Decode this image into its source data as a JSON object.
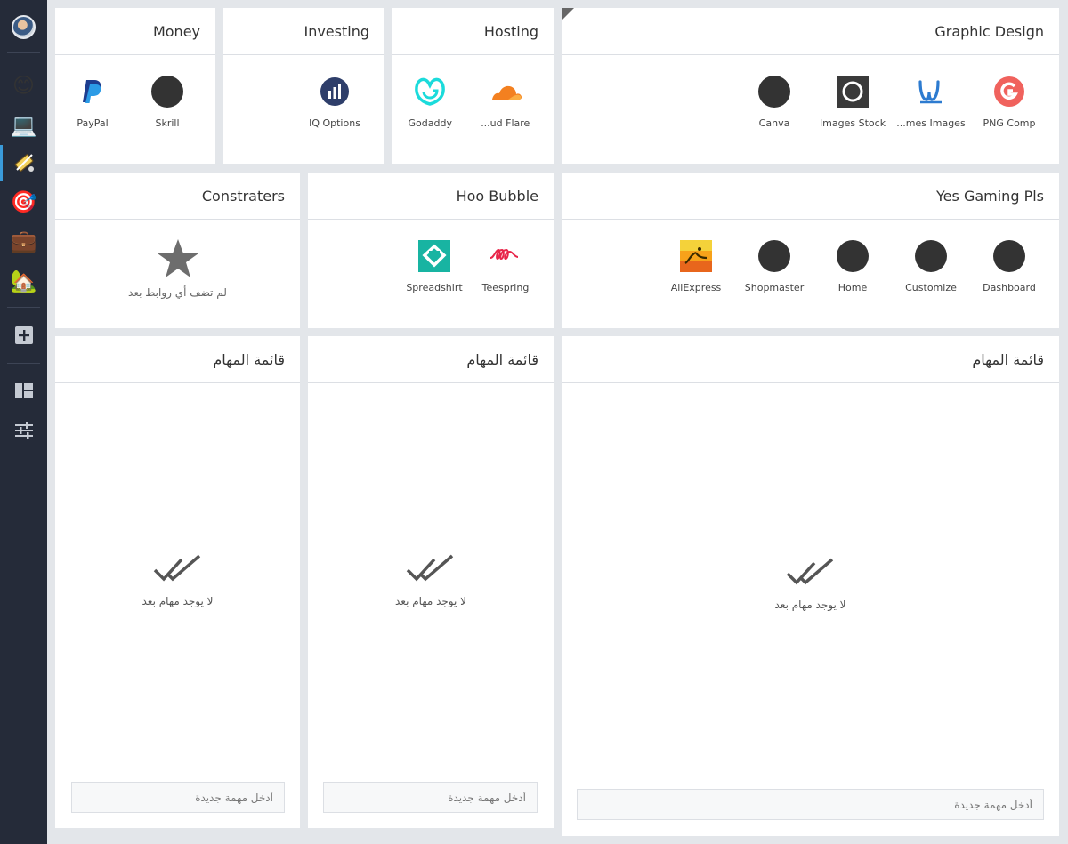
{
  "sidebar": {
    "items": [
      {
        "name": "avatar",
        "icon": "user-avatar"
      },
      {
        "name": "smiley",
        "icon": "smiley-face-icon",
        "glyph": "😊"
      },
      {
        "name": "laptop",
        "icon": "laptop-icon",
        "glyph": "💻"
      },
      {
        "name": "tools",
        "icon": "design-tools-icon",
        "active": true
      },
      {
        "name": "target",
        "icon": "target-icon",
        "glyph": "🎯"
      },
      {
        "name": "briefcase",
        "icon": "briefcase-icon",
        "glyph": "💼"
      },
      {
        "name": "house",
        "icon": "house-icon",
        "glyph": "🏡"
      },
      {
        "name": "add",
        "icon": "add-square-icon"
      },
      {
        "name": "dashboard",
        "icon": "dashboard-grid-icon"
      },
      {
        "name": "settings",
        "icon": "sliders-icon"
      }
    ]
  },
  "cards": {
    "money": {
      "title": "Money",
      "links": [
        {
          "label": "PayPal",
          "icon": "paypal-icon"
        },
        {
          "label": "Skrill",
          "icon": "dot"
        }
      ]
    },
    "investing": {
      "title": "Investing",
      "links": [
        {
          "label": "IQ Options",
          "icon": "iq-option-icon"
        }
      ]
    },
    "hosting": {
      "title": "Hosting",
      "links": [
        {
          "label": "Godaddy",
          "icon": "godaddy-icon"
        },
        {
          "label": "...ud Flare",
          "icon": "cloudflare-icon"
        }
      ]
    },
    "graphic": {
      "title": "Graphic Design",
      "links": [
        {
          "label": "Canva",
          "icon": "dot"
        },
        {
          "label": "Images Stock",
          "icon": "images-stock-icon"
        },
        {
          "label": "...mes Images",
          "icon": "w-logo-icon"
        },
        {
          "label": "PNG Comp",
          "icon": "png-comp-icon"
        }
      ]
    },
    "constraters": {
      "title": "Constraters",
      "empty_text": "لم تضف أي روابط بعد"
    },
    "hoo": {
      "title": "Hoo Bubble",
      "links": [
        {
          "label": "Spreadshirt",
          "icon": "spreadshirt-icon"
        },
        {
          "label": "Teespring",
          "icon": "teespring-icon"
        }
      ]
    },
    "gaming": {
      "title": "Yes Gaming Pls",
      "links": [
        {
          "label": "AliExpress",
          "icon": "aliexpress-icon"
        },
        {
          "label": "Shopmaster",
          "icon": "dot"
        },
        {
          "label": "Home",
          "icon": "dot"
        },
        {
          "label": "Customize",
          "icon": "dot"
        },
        {
          "label": "Dashboard",
          "icon": "dot"
        }
      ]
    }
  },
  "todos": [
    {
      "title": "قائمة المهام",
      "empty_text": "لا يوجد مهام بعد",
      "placeholder": "أدخل مهمة جديدة"
    },
    {
      "title": "قائمة المهام",
      "empty_text": "لا يوجد مهام بعد",
      "placeholder": "أدخل مهمة جديدة"
    },
    {
      "title": "قائمة المهام",
      "empty_text": "لا يوجد مهام بعد",
      "placeholder": "أدخل مهمة جديدة"
    }
  ]
}
